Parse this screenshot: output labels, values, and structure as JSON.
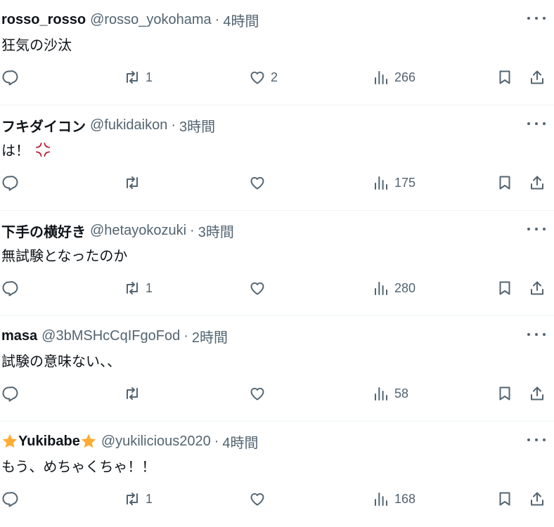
{
  "icons": {
    "reply": "reply-icon",
    "retweet": "retweet-icon",
    "like": "heart-icon",
    "views": "views-icon",
    "bookmark": "bookmark-icon",
    "share": "share-icon",
    "more": "more-icon"
  },
  "colors": {
    "text": "#0f1419",
    "secondary": "#536471",
    "divider": "#eff3f4",
    "star": "#ffac33",
    "anger": "#be1931"
  },
  "tweets": [
    {
      "name": "rosso_rosso",
      "handle": "@rosso_yokohama",
      "sep": "·",
      "time": "4時間",
      "text": "狂気の沙汰",
      "retweets": "1",
      "likes": "2",
      "views": "266"
    },
    {
      "name": "フキダイコン",
      "handle": "@fukidaikon",
      "sep": "·",
      "time": "3時間",
      "text": "は！",
      "retweets": "",
      "likes": "",
      "views": "175"
    },
    {
      "name": "下手の横好き",
      "handle": "@hetayokozuki",
      "sep": "·",
      "time": "3時間",
      "text": "無試験となったのか",
      "retweets": "1",
      "likes": "",
      "views": "280"
    },
    {
      "name": "masa",
      "handle": "@3bMSHcCqIFgoFod",
      "sep": "·",
      "time": "2時間",
      "text": "試験の意味ない、、",
      "retweets": "",
      "likes": "",
      "views": "58"
    },
    {
      "name": "Yukibabe",
      "handle": "@yukilicious2020",
      "sep": "·",
      "time": "4時間",
      "text": "もう、めちゃくちゃ！！",
      "retweets": "1",
      "likes": "",
      "views": "168"
    }
  ]
}
